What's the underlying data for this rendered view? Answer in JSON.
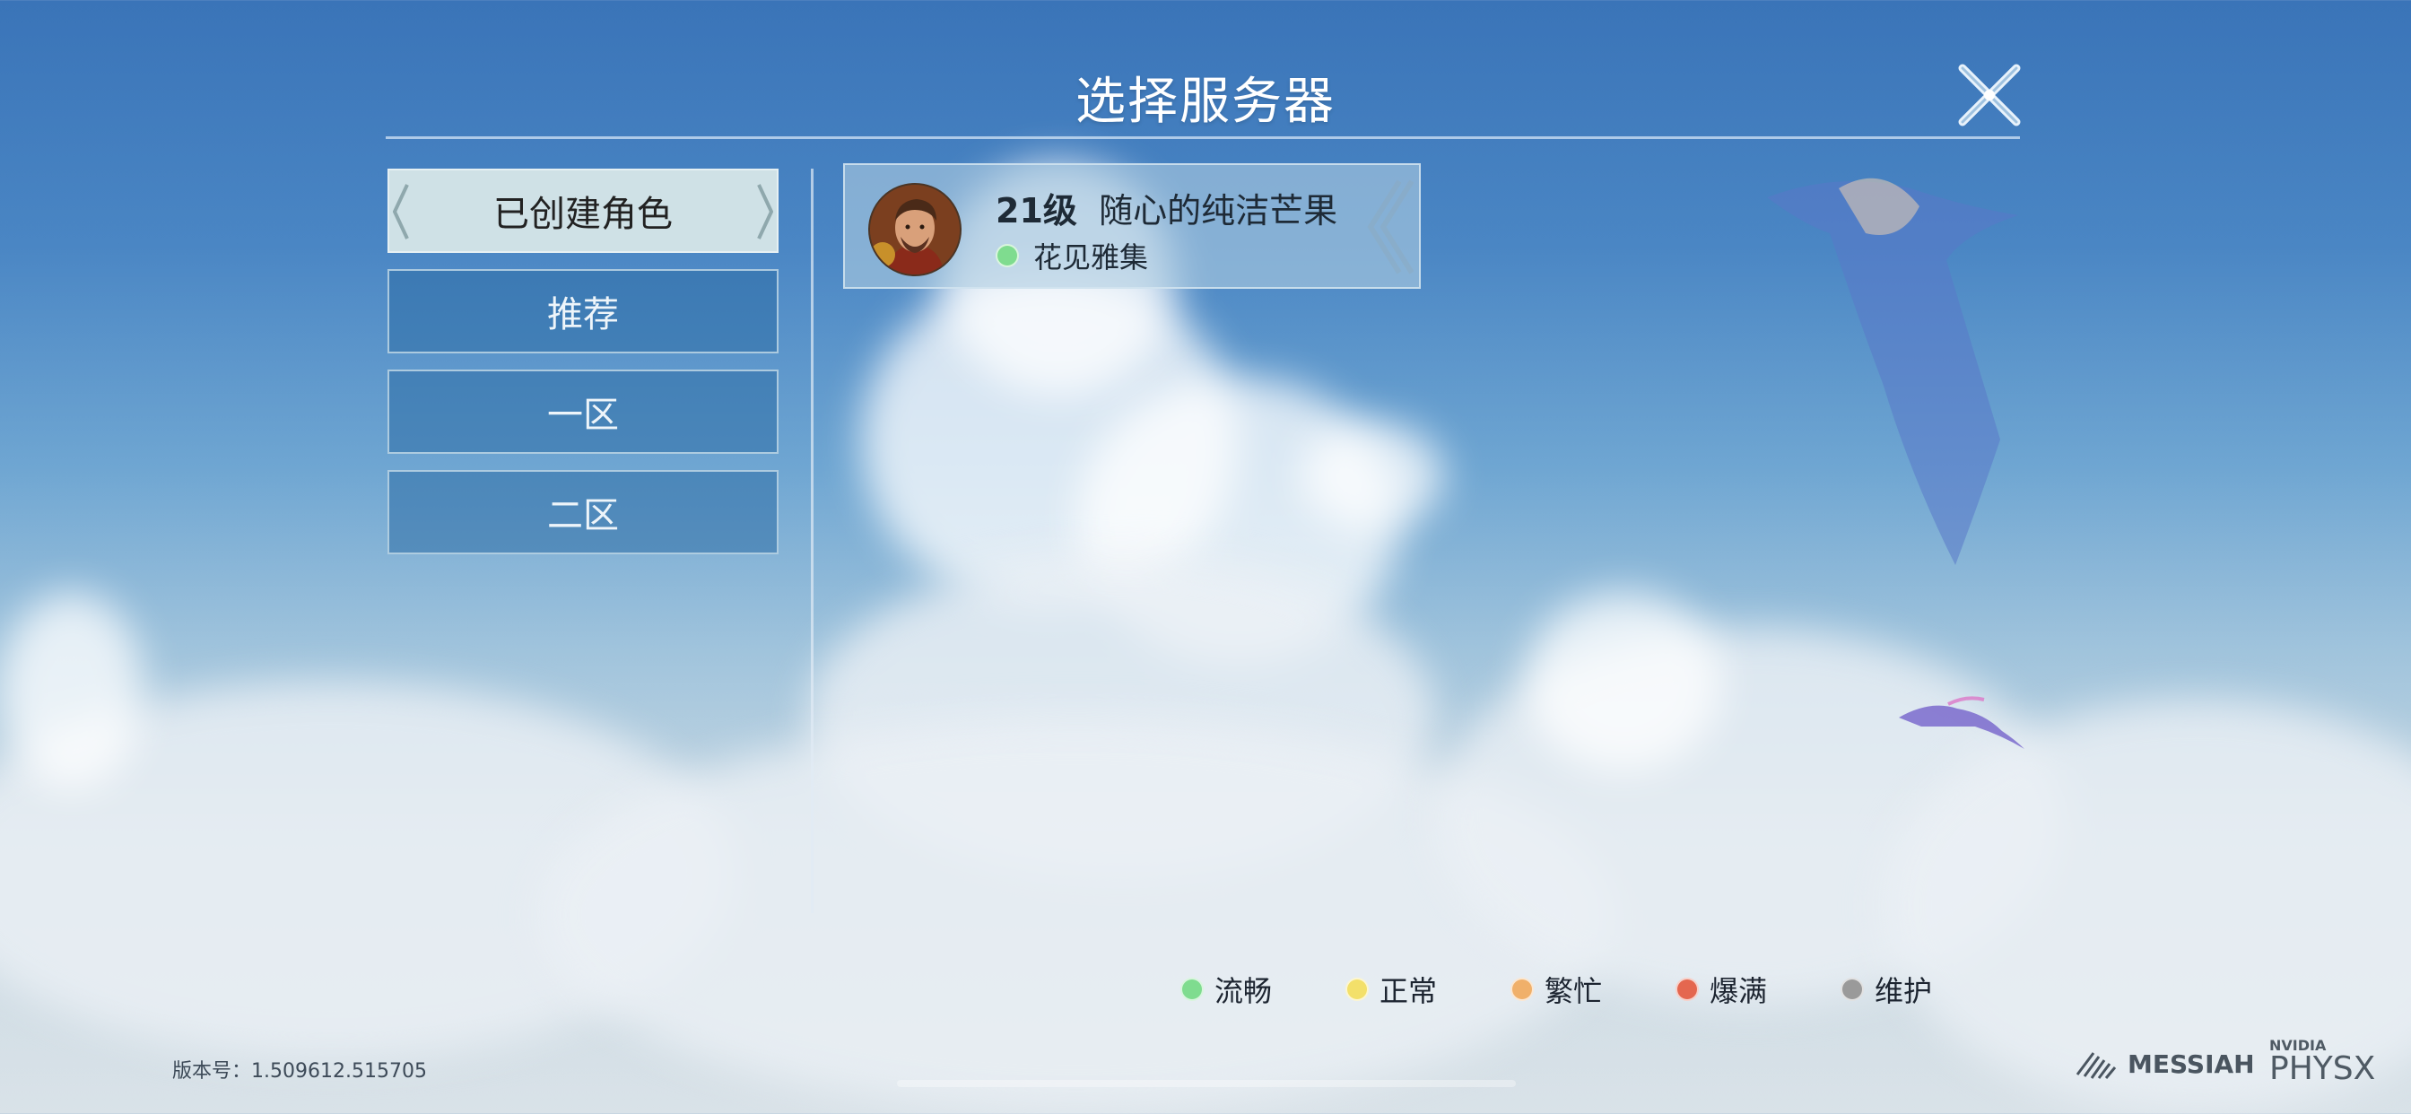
{
  "header": {
    "title": "选择服务器"
  },
  "tabs": [
    {
      "label": "已创建角色",
      "active": true
    },
    {
      "label": "推荐",
      "active": false
    },
    {
      "label": "一区",
      "active": false
    },
    {
      "label": "二区",
      "active": false
    }
  ],
  "characters": [
    {
      "level": "21级",
      "name": "随心的纯洁芒果",
      "server": "花见雅集",
      "server_status": "流畅",
      "status_color": "#7fdc8f"
    }
  ],
  "legend": [
    {
      "label": "流畅",
      "color": "#7fdc8f"
    },
    {
      "label": "正常",
      "color": "#f3e06a"
    },
    {
      "label": "繁忙",
      "color": "#f0b06a"
    },
    {
      "label": "爆满",
      "color": "#e4674f"
    },
    {
      "label": "维护",
      "color": "#9a9a9a"
    }
  ],
  "footer": {
    "version": "版本号：1.509612.515705",
    "logo_messiah": "MESSIAH",
    "logo_nvidia": "NVIDIA",
    "logo_physx": "PHYSX"
  },
  "icons": {
    "close": "close-icon",
    "avatar": "character-avatar"
  }
}
